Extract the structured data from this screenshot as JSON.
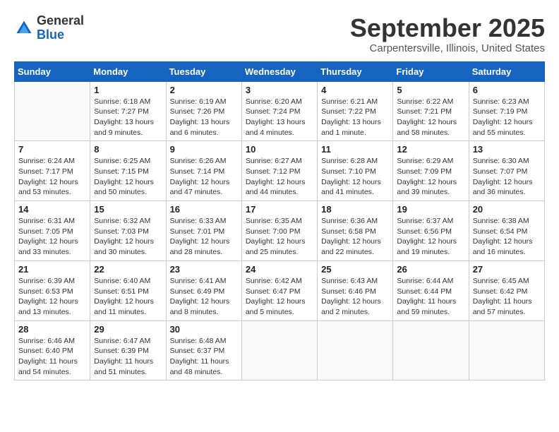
{
  "header": {
    "logo": {
      "general": "General",
      "blue": "Blue"
    },
    "title": "September 2025",
    "location": "Carpentersville, Illinois, United States"
  },
  "calendar": {
    "weekdays": [
      "Sunday",
      "Monday",
      "Tuesday",
      "Wednesday",
      "Thursday",
      "Friday",
      "Saturday"
    ],
    "weeks": [
      [
        {
          "day": "",
          "sunrise": "",
          "sunset": "",
          "daylight": ""
        },
        {
          "day": "1",
          "sunrise": "Sunrise: 6:18 AM",
          "sunset": "Sunset: 7:27 PM",
          "daylight": "Daylight: 13 hours and 9 minutes."
        },
        {
          "day": "2",
          "sunrise": "Sunrise: 6:19 AM",
          "sunset": "Sunset: 7:26 PM",
          "daylight": "Daylight: 13 hours and 6 minutes."
        },
        {
          "day": "3",
          "sunrise": "Sunrise: 6:20 AM",
          "sunset": "Sunset: 7:24 PM",
          "daylight": "Daylight: 13 hours and 4 minutes."
        },
        {
          "day": "4",
          "sunrise": "Sunrise: 6:21 AM",
          "sunset": "Sunset: 7:22 PM",
          "daylight": "Daylight: 13 hours and 1 minute."
        },
        {
          "day": "5",
          "sunrise": "Sunrise: 6:22 AM",
          "sunset": "Sunset: 7:21 PM",
          "daylight": "Daylight: 12 hours and 58 minutes."
        },
        {
          "day": "6",
          "sunrise": "Sunrise: 6:23 AM",
          "sunset": "Sunset: 7:19 PM",
          "daylight": "Daylight: 12 hours and 55 minutes."
        }
      ],
      [
        {
          "day": "7",
          "sunrise": "Sunrise: 6:24 AM",
          "sunset": "Sunset: 7:17 PM",
          "daylight": "Daylight: 12 hours and 53 minutes."
        },
        {
          "day": "8",
          "sunrise": "Sunrise: 6:25 AM",
          "sunset": "Sunset: 7:15 PM",
          "daylight": "Daylight: 12 hours and 50 minutes."
        },
        {
          "day": "9",
          "sunrise": "Sunrise: 6:26 AM",
          "sunset": "Sunset: 7:14 PM",
          "daylight": "Daylight: 12 hours and 47 minutes."
        },
        {
          "day": "10",
          "sunrise": "Sunrise: 6:27 AM",
          "sunset": "Sunset: 7:12 PM",
          "daylight": "Daylight: 12 hours and 44 minutes."
        },
        {
          "day": "11",
          "sunrise": "Sunrise: 6:28 AM",
          "sunset": "Sunset: 7:10 PM",
          "daylight": "Daylight: 12 hours and 41 minutes."
        },
        {
          "day": "12",
          "sunrise": "Sunrise: 6:29 AM",
          "sunset": "Sunset: 7:09 PM",
          "daylight": "Daylight: 12 hours and 39 minutes."
        },
        {
          "day": "13",
          "sunrise": "Sunrise: 6:30 AM",
          "sunset": "Sunset: 7:07 PM",
          "daylight": "Daylight: 12 hours and 36 minutes."
        }
      ],
      [
        {
          "day": "14",
          "sunrise": "Sunrise: 6:31 AM",
          "sunset": "Sunset: 7:05 PM",
          "daylight": "Daylight: 12 hours and 33 minutes."
        },
        {
          "day": "15",
          "sunrise": "Sunrise: 6:32 AM",
          "sunset": "Sunset: 7:03 PM",
          "daylight": "Daylight: 12 hours and 30 minutes."
        },
        {
          "day": "16",
          "sunrise": "Sunrise: 6:33 AM",
          "sunset": "Sunset: 7:01 PM",
          "daylight": "Daylight: 12 hours and 28 minutes."
        },
        {
          "day": "17",
          "sunrise": "Sunrise: 6:35 AM",
          "sunset": "Sunset: 7:00 PM",
          "daylight": "Daylight: 12 hours and 25 minutes."
        },
        {
          "day": "18",
          "sunrise": "Sunrise: 6:36 AM",
          "sunset": "Sunset: 6:58 PM",
          "daylight": "Daylight: 12 hours and 22 minutes."
        },
        {
          "day": "19",
          "sunrise": "Sunrise: 6:37 AM",
          "sunset": "Sunset: 6:56 PM",
          "daylight": "Daylight: 12 hours and 19 minutes."
        },
        {
          "day": "20",
          "sunrise": "Sunrise: 6:38 AM",
          "sunset": "Sunset: 6:54 PM",
          "daylight": "Daylight: 12 hours and 16 minutes."
        }
      ],
      [
        {
          "day": "21",
          "sunrise": "Sunrise: 6:39 AM",
          "sunset": "Sunset: 6:53 PM",
          "daylight": "Daylight: 12 hours and 13 minutes."
        },
        {
          "day": "22",
          "sunrise": "Sunrise: 6:40 AM",
          "sunset": "Sunset: 6:51 PM",
          "daylight": "Daylight: 12 hours and 11 minutes."
        },
        {
          "day": "23",
          "sunrise": "Sunrise: 6:41 AM",
          "sunset": "Sunset: 6:49 PM",
          "daylight": "Daylight: 12 hours and 8 minutes."
        },
        {
          "day": "24",
          "sunrise": "Sunrise: 6:42 AM",
          "sunset": "Sunset: 6:47 PM",
          "daylight": "Daylight: 12 hours and 5 minutes."
        },
        {
          "day": "25",
          "sunrise": "Sunrise: 6:43 AM",
          "sunset": "Sunset: 6:46 PM",
          "daylight": "Daylight: 12 hours and 2 minutes."
        },
        {
          "day": "26",
          "sunrise": "Sunrise: 6:44 AM",
          "sunset": "Sunset: 6:44 PM",
          "daylight": "Daylight: 11 hours and 59 minutes."
        },
        {
          "day": "27",
          "sunrise": "Sunrise: 6:45 AM",
          "sunset": "Sunset: 6:42 PM",
          "daylight": "Daylight: 11 hours and 57 minutes."
        }
      ],
      [
        {
          "day": "28",
          "sunrise": "Sunrise: 6:46 AM",
          "sunset": "Sunset: 6:40 PM",
          "daylight": "Daylight: 11 hours and 54 minutes."
        },
        {
          "day": "29",
          "sunrise": "Sunrise: 6:47 AM",
          "sunset": "Sunset: 6:39 PM",
          "daylight": "Daylight: 11 hours and 51 minutes."
        },
        {
          "day": "30",
          "sunrise": "Sunrise: 6:48 AM",
          "sunset": "Sunset: 6:37 PM",
          "daylight": "Daylight: 11 hours and 48 minutes."
        },
        {
          "day": "",
          "sunrise": "",
          "sunset": "",
          "daylight": ""
        },
        {
          "day": "",
          "sunrise": "",
          "sunset": "",
          "daylight": ""
        },
        {
          "day": "",
          "sunrise": "",
          "sunset": "",
          "daylight": ""
        },
        {
          "day": "",
          "sunrise": "",
          "sunset": "",
          "daylight": ""
        }
      ]
    ]
  }
}
